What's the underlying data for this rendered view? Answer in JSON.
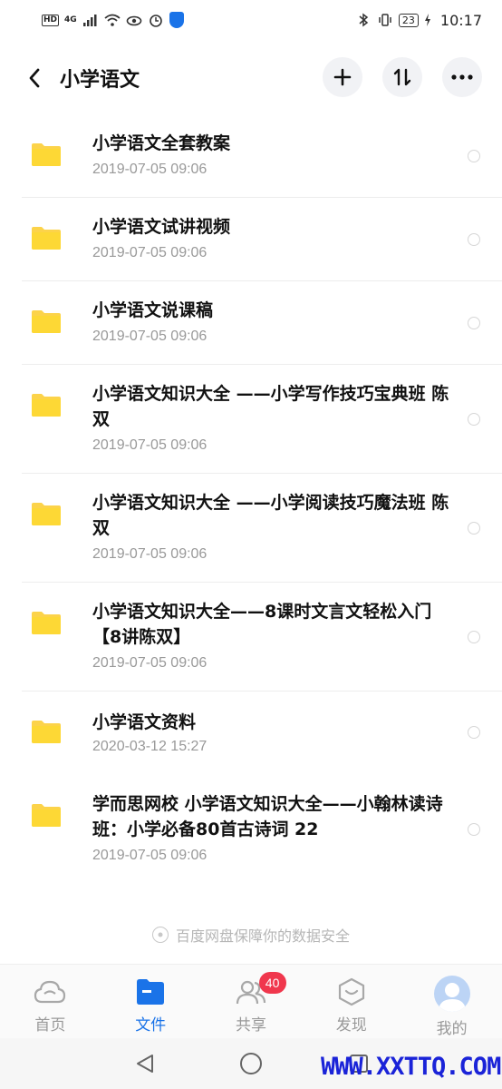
{
  "status_bar": {
    "hd": "HD",
    "signal": "4G",
    "battery": "23",
    "time": "10:17"
  },
  "header": {
    "title": "小学语文",
    "icons": [
      "back-arrow-icon",
      "plus-icon",
      "sort-icon",
      "more-icon"
    ]
  },
  "files": [
    {
      "name": "小学语文全套教案",
      "date": "2019-07-05  09:06"
    },
    {
      "name": "小学语文试讲视频",
      "date": "2019-07-05  09:06"
    },
    {
      "name": "小学语文说课稿",
      "date": "2019-07-05  09:06"
    },
    {
      "name": "小学语文知识大全 ——小学写作技巧宝典班 陈双",
      "date": "2019-07-05  09:06"
    },
    {
      "name": "小学语文知识大全 ——小学阅读技巧魔法班 陈双",
      "date": "2019-07-05  09:06"
    },
    {
      "name": "小学语文知识大全——8课时文言文轻松入门【8讲陈双】",
      "date": "2019-07-05  09:06"
    },
    {
      "name": "小学语文资料",
      "date": "2020-03-12  15:27"
    },
    {
      "name": "学而思网校 小学语文知识大全——小翰林读诗班：小学必备80首古诗词 22",
      "date": "2019-07-05  09:06"
    }
  ],
  "safety_note": "百度网盘保障你的数据安全",
  "tabs": [
    {
      "label": "首页",
      "icon": "cloud-icon",
      "active": false
    },
    {
      "label": "文件",
      "icon": "folder-icon",
      "active": true
    },
    {
      "label": "共享",
      "icon": "people-icon",
      "active": false,
      "badge": "40"
    },
    {
      "label": "发现",
      "icon": "discover-icon",
      "active": false
    },
    {
      "label": "我的",
      "icon": "avatar-icon",
      "active": false
    }
  ],
  "watermark": "WWW.XXTTQ.COM",
  "colors": {
    "accent": "#1a73e8",
    "folder": "#fcd34a",
    "badge": "#f0374d",
    "watermark": "#1a23d8"
  }
}
